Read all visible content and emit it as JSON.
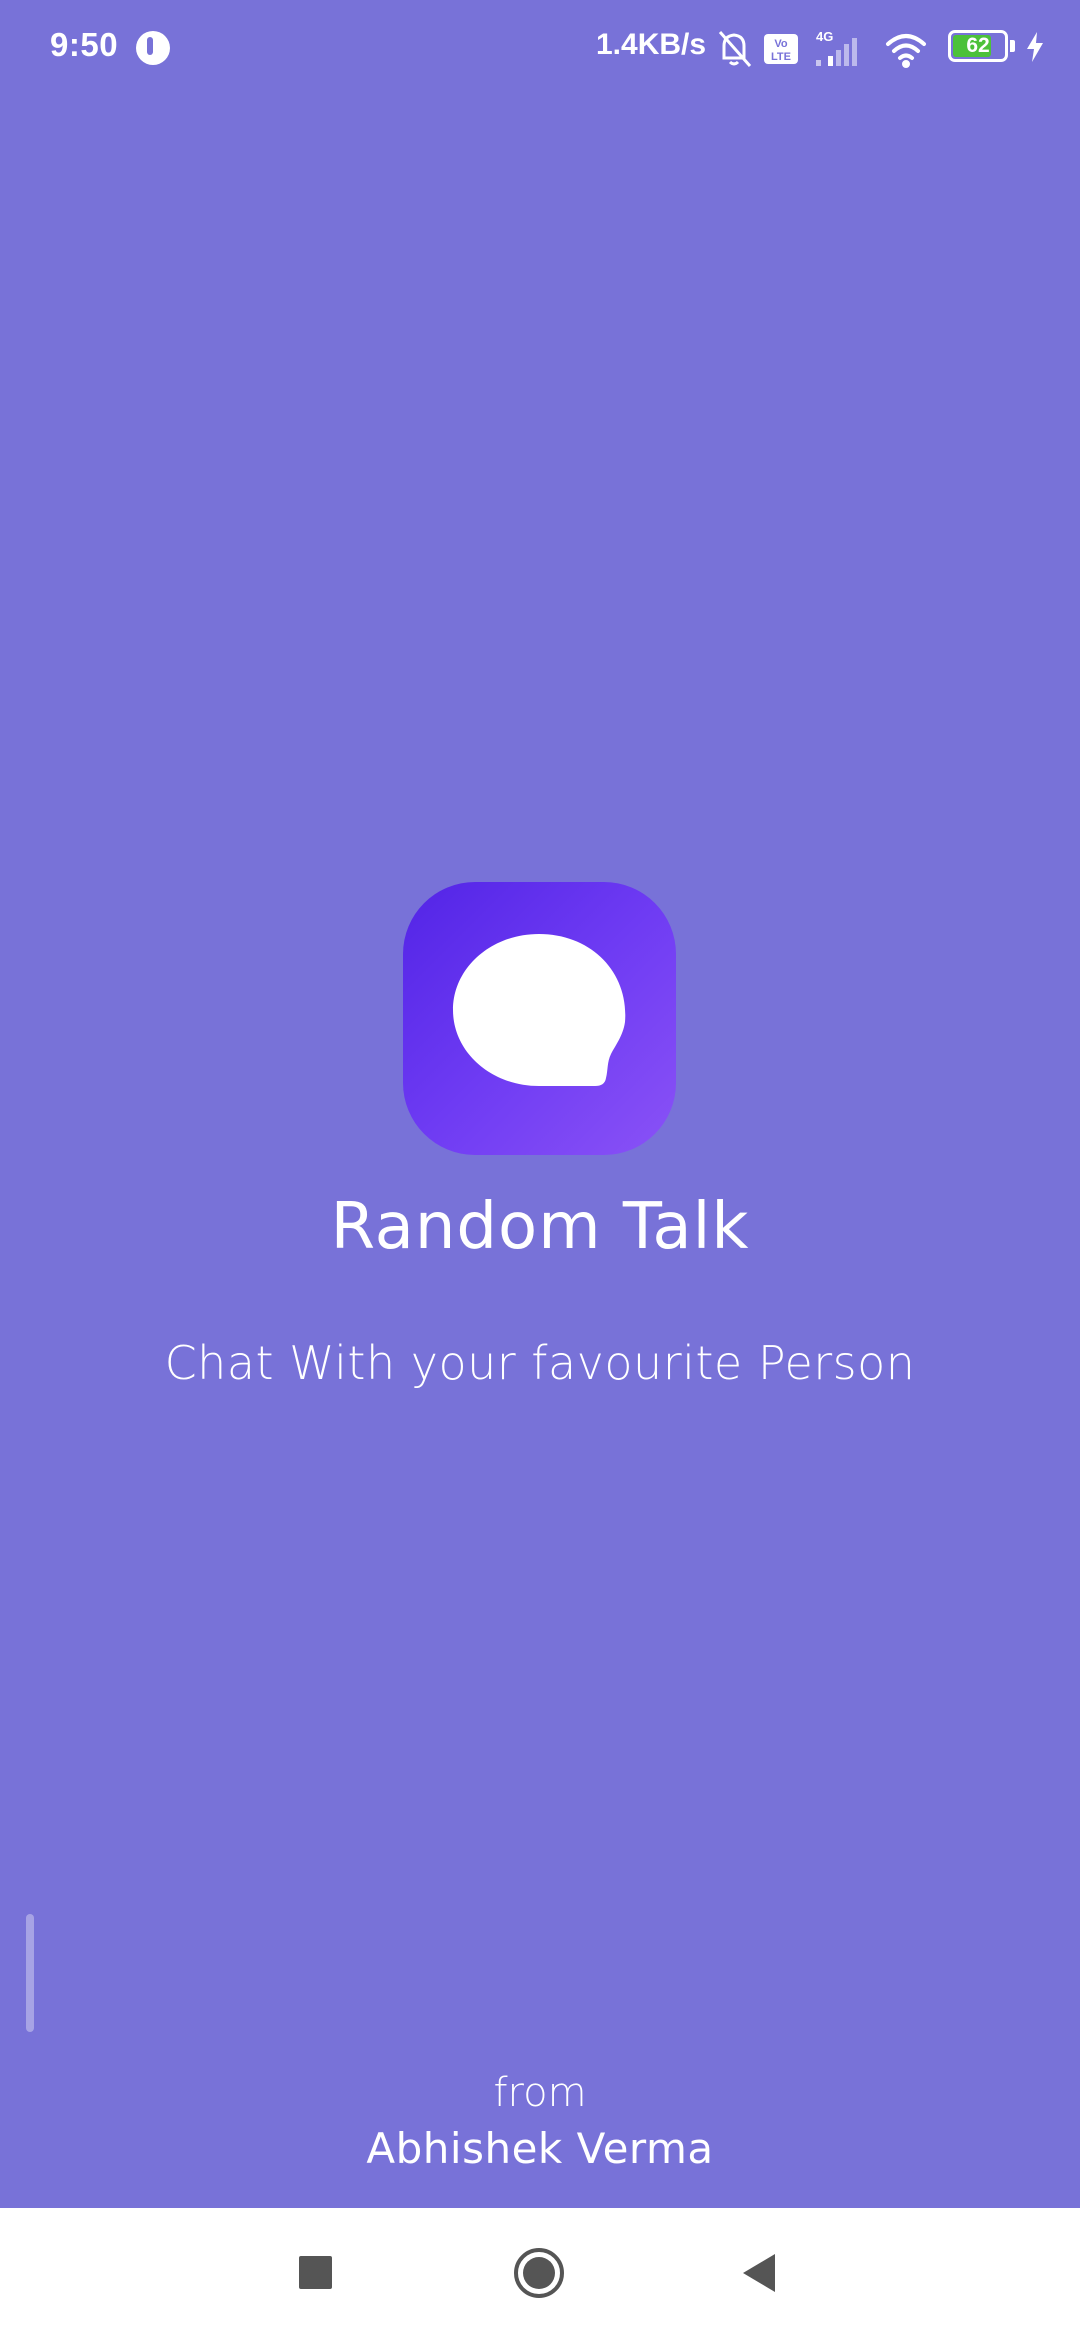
{
  "status_bar": {
    "time": "9:50",
    "network_speed": "1.4KB/s",
    "battery_level": "62",
    "icons": [
      "app-notification-icon",
      "mute-icon",
      "volte-icon",
      "4g-signal-icon",
      "wifi-icon",
      "battery-icon",
      "charging-icon"
    ],
    "volte_label": "Vo LTE",
    "network_type": "4G"
  },
  "splash": {
    "app_name": "Random Talk",
    "tagline": "Chat With your favourite Person",
    "from_label": "from",
    "author": "Abhishek Verma"
  },
  "colors": {
    "background": "#7872D8",
    "logo_gradient_start": "#5224E6",
    "logo_gradient_end": "#8A52F6",
    "nav_bar": "#ffffff",
    "battery_fill": "#4CC13A"
  },
  "nav_bar": {
    "buttons": [
      "recents-button",
      "home-button",
      "back-button"
    ]
  }
}
